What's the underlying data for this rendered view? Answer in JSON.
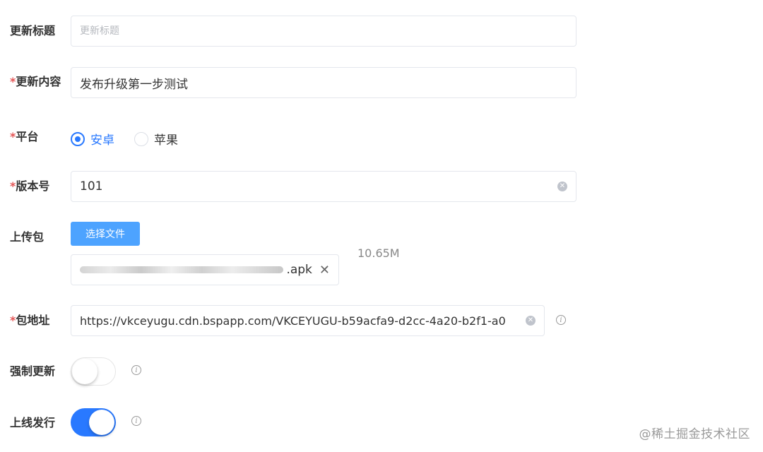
{
  "form": {
    "title_field": {
      "label": "更新标题",
      "value": "",
      "placeholder": "更新标题"
    },
    "content_field": {
      "required_mark": "*",
      "label": "更新内容",
      "value": "发布升级第一步测试"
    },
    "platform": {
      "required_mark": "*",
      "label": "平台",
      "options": [
        {
          "label": "安卓",
          "selected": true
        },
        {
          "label": "苹果",
          "selected": false
        }
      ]
    },
    "version_field": {
      "required_mark": "*",
      "label": "版本号",
      "value": "101"
    },
    "upload": {
      "label": "上传包",
      "button_label": "选择文件",
      "file_name_suffix": ".apk",
      "file_size": "10.65M"
    },
    "package_url": {
      "required_mark": "*",
      "label": "包地址",
      "value": "https://vkceyugu.cdn.bspapp.com/VKCEYUGU-b59acfa9-d2cc-4a20-b2f1-a0"
    },
    "force_update": {
      "label": "强制更新",
      "enabled": false
    },
    "publish_online": {
      "label": "上线发行",
      "enabled": true
    }
  },
  "icons": {
    "clear": "clear-circle-icon",
    "info": "info-circle-icon",
    "remove": "close-icon"
  },
  "colors": {
    "primary": "#2979ff",
    "upload_button": "#4da3ff",
    "required": "#e45656"
  },
  "watermark": "@稀土掘金技术社区"
}
